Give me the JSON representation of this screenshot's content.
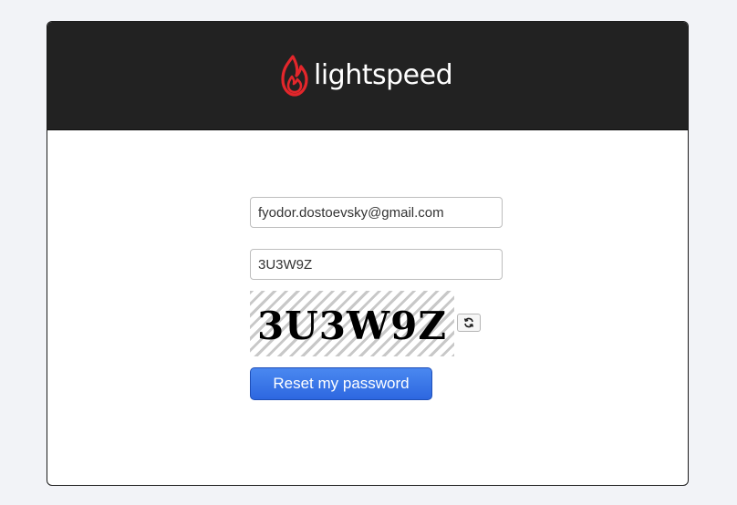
{
  "brand": {
    "name": "lightspeed",
    "logo_icon": "flame-icon",
    "accent_color": "#e3262b",
    "header_color": "#222222"
  },
  "form": {
    "email_value": "fyodor.dostoevsky@gmail.com",
    "captcha_input_value": "3U3W9Z",
    "captcha_image_text": "3U3W9Z",
    "refresh_icon": "refresh-icon",
    "submit_label": "Reset my password",
    "button_color": "#2f6ae2"
  }
}
